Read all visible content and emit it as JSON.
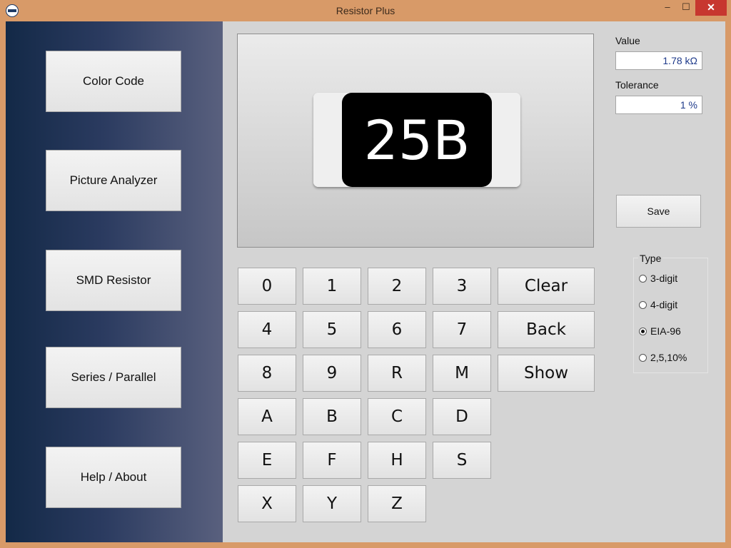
{
  "window": {
    "title": "Resistor Plus",
    "minimize": "–",
    "maximize": "☐",
    "close": "✕"
  },
  "sidebar": {
    "items": [
      {
        "label": "Color Code"
      },
      {
        "label": "Picture Analyzer"
      },
      {
        "label": "SMD Resistor"
      },
      {
        "label": "Series / Parallel"
      },
      {
        "label": "Help / About"
      }
    ]
  },
  "display": {
    "code": "25B"
  },
  "keypad": {
    "keys": [
      "0",
      "1",
      "2",
      "3",
      "4",
      "5",
      "6",
      "7",
      "8",
      "9",
      "R",
      "M",
      "A",
      "B",
      "C",
      "D",
      "E",
      "F",
      "H",
      "S",
      "X",
      "Y",
      "Z"
    ],
    "clear": "Clear",
    "back": "Back",
    "show": "Show"
  },
  "result": {
    "value_label": "Value",
    "value": "1.78 kΩ",
    "tolerance_label": "Tolerance",
    "tolerance": "1 %",
    "save": "Save"
  },
  "type": {
    "legend": "Type",
    "options": [
      "3-digit",
      "4-digit",
      "EIA-96",
      "2,5,10%"
    ],
    "selected": "EIA-96"
  }
}
